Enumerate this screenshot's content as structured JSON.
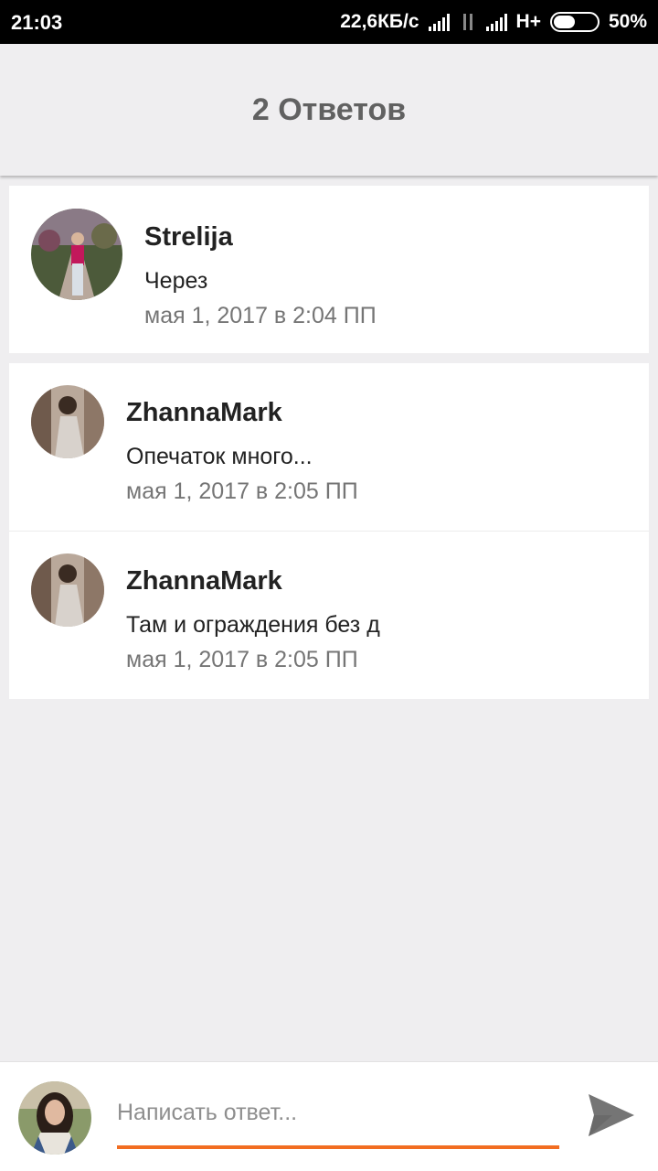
{
  "status_bar": {
    "time": "21:03",
    "speed": "22,6КБ/с",
    "network": "H+",
    "battery": "50%"
  },
  "header": {
    "title": "2 Ответов"
  },
  "replies": [
    {
      "author": "Strelija",
      "text": "Через",
      "date": "мая 1, 2017 в 2:04 ПП"
    },
    {
      "author": "ZhannaMark",
      "text": "Опечаток много...",
      "date": "мая 1, 2017 в 2:05 ПП"
    },
    {
      "author": "ZhannaMark",
      "text": "Там и ограждения без д",
      "date": "мая 1, 2017 в 2:05 ПП"
    }
  ],
  "composer": {
    "placeholder": "Написать ответ...",
    "send_icon": "send-icon"
  },
  "colors": {
    "accent": "#f26d21",
    "background": "#efeef0",
    "text_secondary": "#757575"
  }
}
